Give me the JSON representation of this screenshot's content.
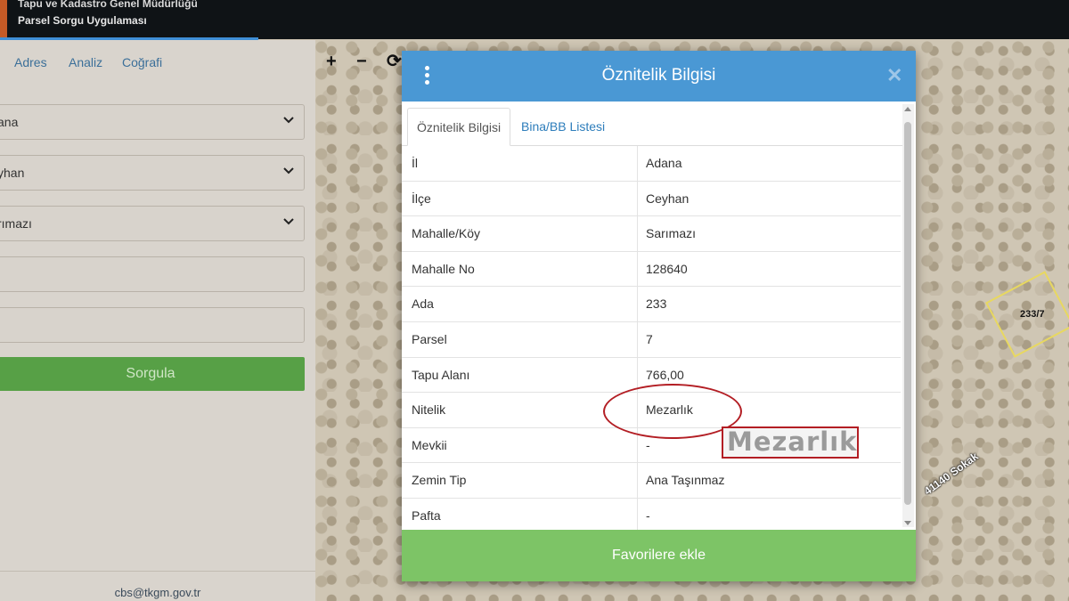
{
  "header": {
    "line1": "Tapu ve Kadastro Genel Müdürlüğü",
    "line2": "Parsel Sorgu Uygulaması"
  },
  "left_panel": {
    "tabs": [
      "Adres",
      "Analiz",
      "Coğrafi"
    ],
    "fields": [
      {
        "value": "ana",
        "type": "select"
      },
      {
        "value": "yhan",
        "type": "select"
      },
      {
        "value": "rımazı",
        "type": "select"
      },
      {
        "value": "",
        "type": "input"
      },
      {
        "value": "",
        "type": "input"
      }
    ],
    "submit_label": "Sorgula",
    "email": "cbs@tkgm.gov.tr"
  },
  "map": {
    "tools": [
      "+",
      "−",
      "⟳"
    ],
    "parcel_label": "233/7",
    "street_label": "41140 Sokak"
  },
  "modal": {
    "title": "Öznitelik Bilgisi",
    "close_symbol": "✕",
    "tabs": [
      "Öznitelik Bilgisi",
      "Bina/BB Listesi"
    ],
    "rows": [
      {
        "key": "İl",
        "value": "Adana"
      },
      {
        "key": "İlçe",
        "value": "Ceyhan"
      },
      {
        "key": "Mahalle/Köy",
        "value": "Sarımazı"
      },
      {
        "key": "Mahalle No",
        "value": "128640"
      },
      {
        "key": "Ada",
        "value": "233"
      },
      {
        "key": "Parsel",
        "value": "7"
      },
      {
        "key": "Tapu Alanı",
        "value": "766,00"
      },
      {
        "key": "Nitelik",
        "value": "Mezarlık"
      },
      {
        "key": "Mevkii",
        "value": "-"
      },
      {
        "key": "Zemin Tip",
        "value": "Ana Taşınmaz"
      },
      {
        "key": "Pafta",
        "value": "-"
      }
    ],
    "favorite_label": "Favorilere ekle"
  },
  "annotation": {
    "zoom_text": "Mezarlık",
    "color": "#b31e24"
  }
}
